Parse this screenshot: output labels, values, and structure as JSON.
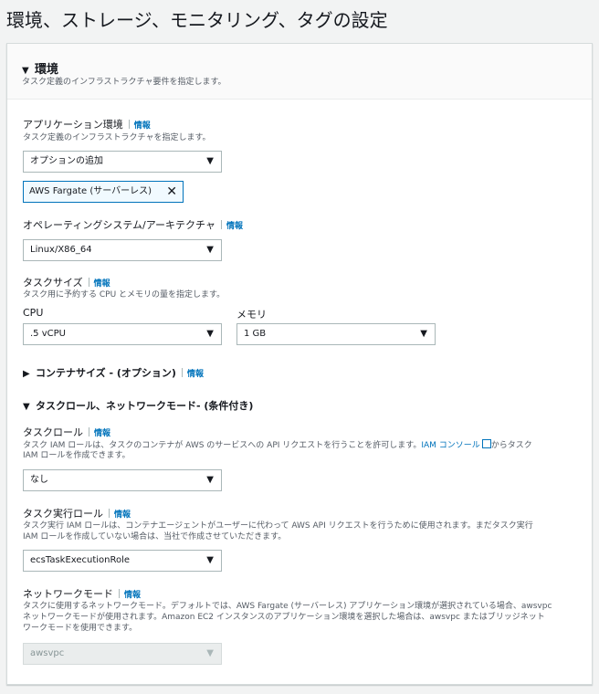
{
  "page": {
    "title": "環境、ストレージ、モニタリング、タグの設定"
  },
  "section": {
    "title": "環境",
    "description": "タスク定義のインフラストラクチャ要件を指定します。"
  },
  "app_env": {
    "label": "アプリケーション環境",
    "info": "情報",
    "description": "タスク定義のインフラストラクチャを指定します。",
    "select_placeholder": "オプションの追加",
    "token": "AWS Fargate (サーバーレス)"
  },
  "os_arch": {
    "label": "オペレーティングシステム/アーキテクチャ",
    "info": "情報",
    "value": "Linux/X86_64"
  },
  "task_size": {
    "label": "タスクサイズ",
    "info": "情報",
    "description": "タスク用に予約する CPU とメモリの量を指定します。",
    "cpu_label": "CPU",
    "cpu_value": ".5 vCPU",
    "memory_label": "メモリ",
    "memory_value": "1 GB"
  },
  "container_size": {
    "label": "コンテナサイズ - (オプション)",
    "info": "情報"
  },
  "role_network": {
    "label": "タスクロール、ネットワークモード- (条件付き)"
  },
  "task_role": {
    "label": "タスクロール",
    "info": "情報",
    "desc_part1": "タスク IAM ロールは、タスクのコンテナが AWS のサービスへの API リクエストを行うことを許可します。",
    "desc_link": "IAM コンソール",
    "desc_part2": "からタスク",
    "desc_line2": "IAM ロールを作成できます。",
    "value": "なし"
  },
  "exec_role": {
    "label": "タスク実行ロール",
    "info": "情報",
    "desc_line1": "タスク実行 IAM ロールは、コンテナエージェントがユーザーに代わって AWS API リクエストを行うために使用されます。まだタスク実行",
    "desc_line2": "IAM ロールを作成していない場合は、当社で作成させていただきます。",
    "value": "ecsTaskExecutionRole"
  },
  "network_mode": {
    "label": "ネットワークモード",
    "info": "情報",
    "desc_line1": "タスクに使用するネットワークモード。デフォルトでは、AWS Fargate (サーバーレス) アプリケーション環境が選択されている場合、awsvpc",
    "desc_line2": "ネットワークモードが使用されます。Amazon EC2 インスタンスのアプリケーション環境を選択した場合は、awsvpc またはブリッジネット",
    "desc_line3": "ワークモードを使用できます。",
    "value": "awsvpc"
  }
}
